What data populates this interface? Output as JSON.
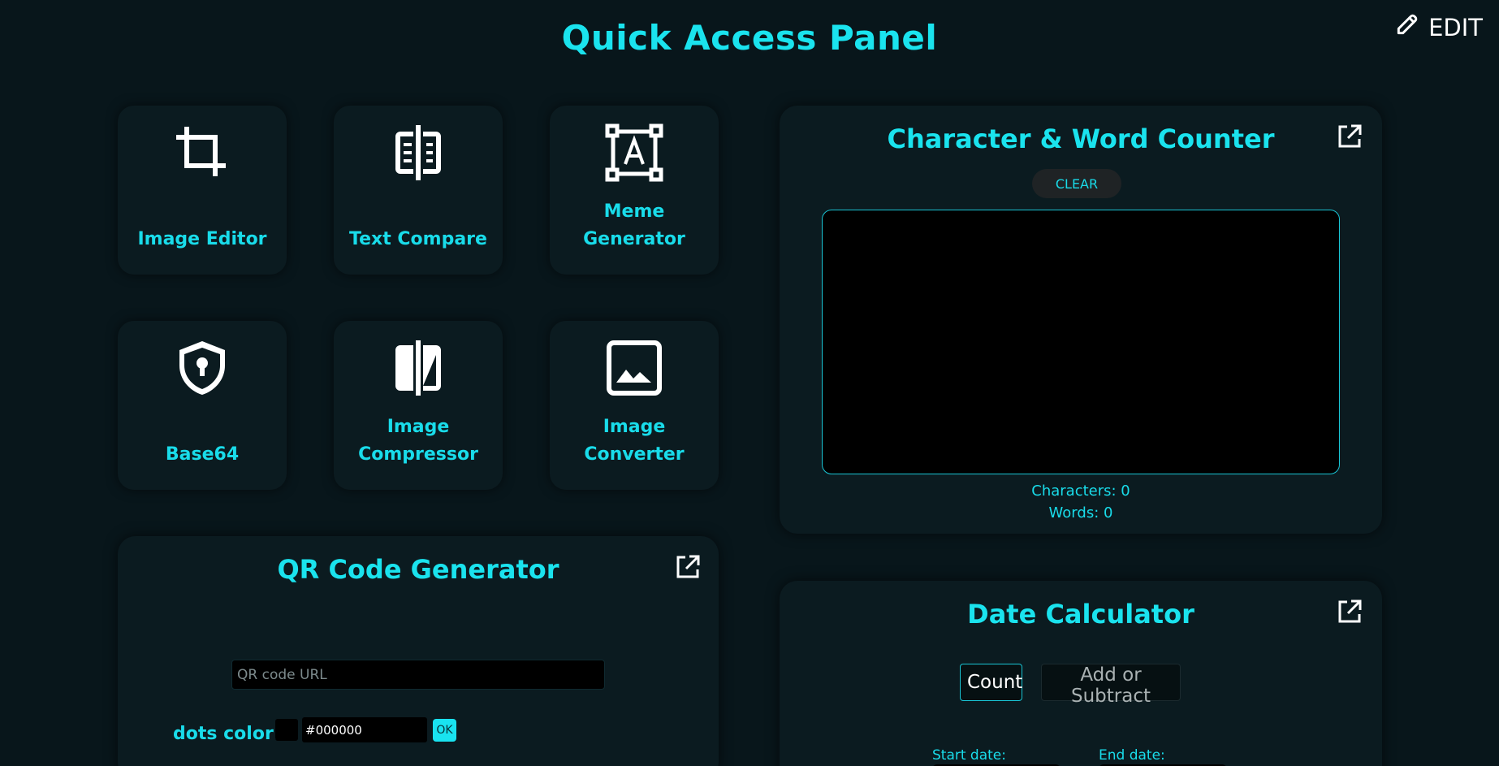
{
  "header": {
    "title": "Quick Access Panel",
    "edit_label": "EDIT"
  },
  "tiles": [
    {
      "label": "Image Editor",
      "icon": "crop-icon"
    },
    {
      "label": "Text Compare",
      "icon": "compare-icon"
    },
    {
      "label": "Meme Generator",
      "icon": "text-box-icon"
    },
    {
      "label": "Base64",
      "icon": "shield-keyhole-icon"
    },
    {
      "label": "Image Compressor",
      "icon": "compress-icon"
    },
    {
      "label": "Image Converter",
      "icon": "image-icon"
    }
  ],
  "counter": {
    "title": "Character & Word Counter",
    "clear_label": "CLEAR",
    "characters_text": "Characters: 0",
    "words_text": "Words: 0"
  },
  "qr": {
    "title": "QR Code Generator",
    "url_placeholder": "QR code URL",
    "dots_color_label": "dots color:",
    "dots_color_value": "#000000",
    "ok_label": "OK"
  },
  "date_calc": {
    "title": "Date Calculator",
    "tab_count": "Count",
    "tab_add_subtract": "Add or Subtract",
    "start_label": "Start date:",
    "end_label": "End date:"
  },
  "colors": {
    "background": "#08161b",
    "card": "#0b1b20",
    "accent": "#19dcea",
    "text_white": "#ffffff"
  }
}
